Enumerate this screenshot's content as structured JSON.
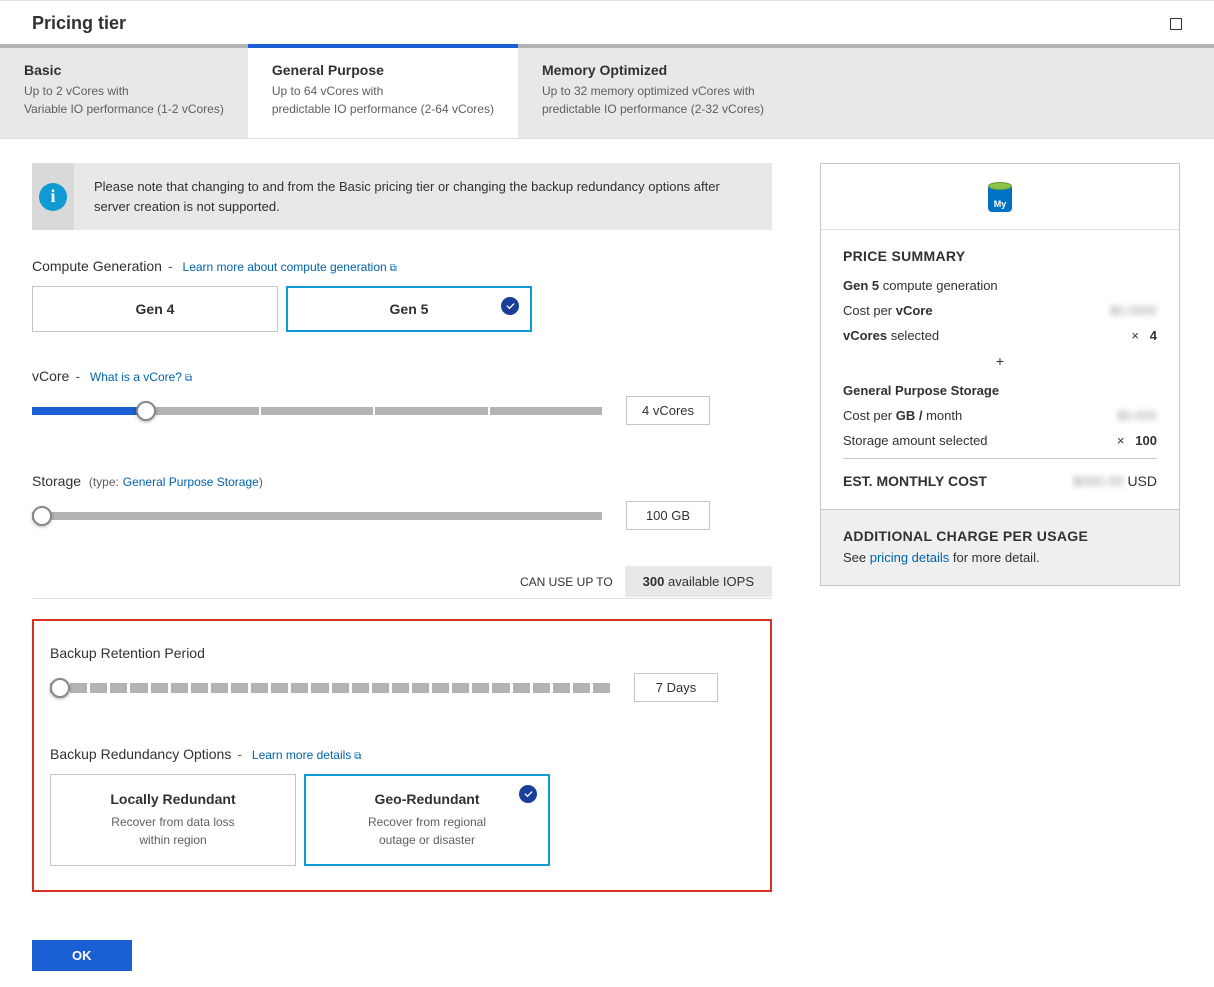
{
  "header": {
    "title": "Pricing tier"
  },
  "tabs": [
    {
      "title": "Basic",
      "line1": "Up to 2 vCores with",
      "line2": "Variable IO performance (1-2 vCores)"
    },
    {
      "title": "General Purpose",
      "line1": "Up to 64 vCores with",
      "line2": "predictable IO performance (2-64 vCores)"
    },
    {
      "title": "Memory Optimized",
      "line1": "Up to 32 memory optimized vCores with",
      "line2": "predictable IO performance (2-32 vCores)"
    }
  ],
  "info_note": "Please note that changing to and from the Basic pricing tier or changing the backup redundancy options after server creation is not supported.",
  "compute_gen": {
    "label": "Compute Generation",
    "learn_more": "Learn more about compute generation",
    "options": [
      {
        "title": "Gen 4"
      },
      {
        "title": "Gen 5"
      }
    ]
  },
  "vcore": {
    "label": "vCore",
    "help": "What is a vCore?",
    "value_display": "4 vCores"
  },
  "storage": {
    "label": "Storage",
    "type_prefix": "(type:",
    "type_link": "General Purpose Storage",
    "type_suffix": ")",
    "value_display": "100 GB",
    "iops_prefix": "CAN USE UP TO",
    "iops_value": "300",
    "iops_suffix": "available IOPS"
  },
  "backup_retention": {
    "label": "Backup Retention Period",
    "value_display": "7 Days"
  },
  "backup_redundancy": {
    "label": "Backup Redundancy Options",
    "learn_more": "Learn more details",
    "options": [
      {
        "title": "Locally Redundant",
        "desc1": "Recover from data loss",
        "desc2": "within region"
      },
      {
        "title": "Geo-Redundant",
        "desc1": "Recover from regional",
        "desc2": "outage or disaster"
      }
    ]
  },
  "price": {
    "summary_title": "PRICE SUMMARY",
    "gen_prefix": "Gen 5",
    "gen_suffix": "compute generation",
    "cost_vcore_label_pre": "Cost per ",
    "cost_vcore_label_b": "vCore",
    "vcores_sel_pre": "vCores ",
    "vcores_sel_suf": "selected",
    "vcores_mult": "×",
    "vcores_val": "4",
    "plus": "+",
    "storage_heading": "General Purpose Storage",
    "cost_gb_pre": "Cost per ",
    "cost_gb_b": "GB / ",
    "cost_gb_suf": "month",
    "storage_sel": "Storage amount selected",
    "storage_mult": "×",
    "storage_val": "100",
    "est_label": "EST. MONTHLY COST",
    "est_currency": "USD",
    "extra_title": "ADDITIONAL CHARGE PER USAGE",
    "extra_pre": "See ",
    "extra_link": "pricing details",
    "extra_suf": " for more detail."
  },
  "ok_label": "OK"
}
